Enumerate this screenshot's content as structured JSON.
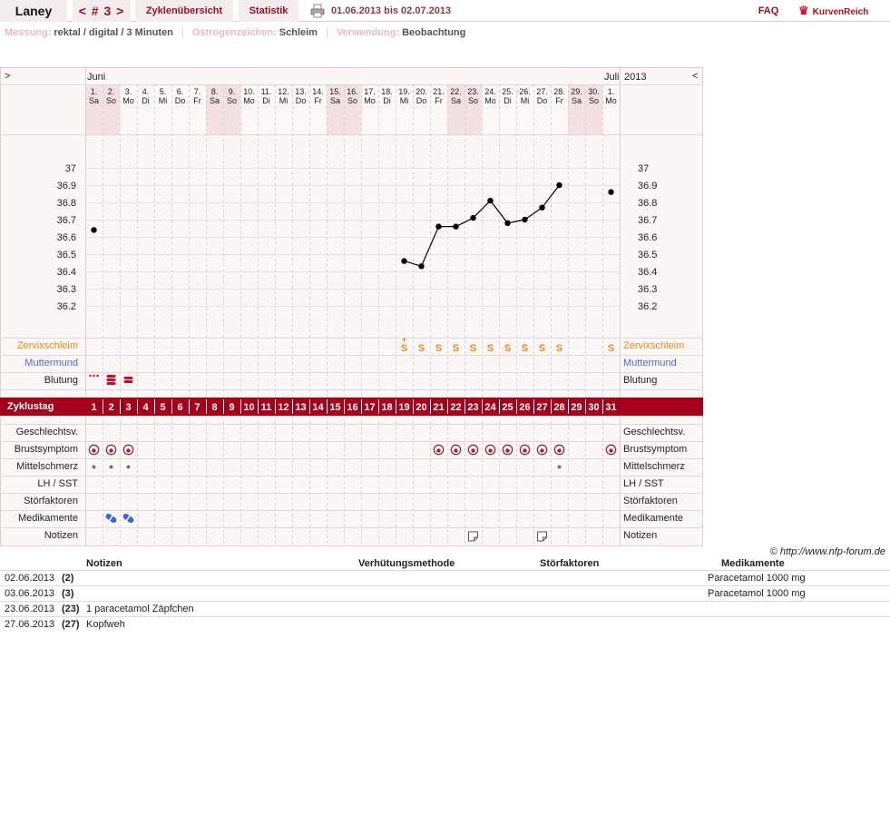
{
  "header": {
    "username": "Laney",
    "cycle_nav": "< # 3 >",
    "tab_overview": "Zyklenübersicht",
    "tab_stats": "Statistik",
    "date_range": "01.06.2013 bis 02.07.2013",
    "faq": "FAQ",
    "brand": "KurvenReich",
    "printer_icon": "printer-icon"
  },
  "info": {
    "measure_label": "Messung:",
    "measure_value": "rektal / digital / 3 Minuten",
    "oestrogen_label": "Östrogenzeichen:",
    "oestrogen_value": "Schleim",
    "usage_label": "Verwendung:",
    "usage_value": "Beobachtung"
  },
  "chart_data": {
    "type": "line",
    "nav_prev": ">",
    "nav_next": "<",
    "month_start": "Juni",
    "month_end": "Juli",
    "year": "2013",
    "days": [
      {
        "d": "1.",
        "w": "Sa",
        "we": true
      },
      {
        "d": "2.",
        "w": "So",
        "we": true
      },
      {
        "d": "3.",
        "w": "Mo",
        "we": false
      },
      {
        "d": "4.",
        "w": "Di",
        "we": false
      },
      {
        "d": "5.",
        "w": "Mi",
        "we": false
      },
      {
        "d": "6.",
        "w": "Do",
        "we": false
      },
      {
        "d": "7.",
        "w": "Fr",
        "we": false
      },
      {
        "d": "8.",
        "w": "Sa",
        "we": true
      },
      {
        "d": "9.",
        "w": "So",
        "we": true
      },
      {
        "d": "10.",
        "w": "Mo",
        "we": false
      },
      {
        "d": "11.",
        "w": "Di",
        "we": false
      },
      {
        "d": "12.",
        "w": "Mi",
        "we": false
      },
      {
        "d": "13.",
        "w": "Do",
        "we": false
      },
      {
        "d": "14.",
        "w": "Fr",
        "we": false
      },
      {
        "d": "15.",
        "w": "Sa",
        "we": true
      },
      {
        "d": "16.",
        "w": "So",
        "we": true
      },
      {
        "d": "17.",
        "w": "Mo",
        "we": false
      },
      {
        "d": "18.",
        "w": "Di",
        "we": false
      },
      {
        "d": "19.",
        "w": "Mi",
        "we": false
      },
      {
        "d": "20.",
        "w": "Do",
        "we": false
      },
      {
        "d": "21.",
        "w": "Fr",
        "we": false
      },
      {
        "d": "22.",
        "w": "Sa",
        "we": true
      },
      {
        "d": "23.",
        "w": "So",
        "we": true
      },
      {
        "d": "24.",
        "w": "Mo",
        "we": false
      },
      {
        "d": "25.",
        "w": "Di",
        "we": false
      },
      {
        "d": "26.",
        "w": "Mi",
        "we": false
      },
      {
        "d": "27.",
        "w": "Do",
        "we": false
      },
      {
        "d": "28.",
        "w": "Fr",
        "we": false
      },
      {
        "d": "29.",
        "w": "Sa",
        "we": true
      },
      {
        "d": "30.",
        "w": "So",
        "we": true
      },
      {
        "d": "1.",
        "w": "Mo",
        "we": false
      }
    ],
    "y_ticks": [
      "37",
      "36.9",
      "36.8",
      "36.7",
      "36.6",
      "36.5",
      "36.4",
      "36.3",
      "36.2"
    ],
    "ylim": [
      36.1,
      37.05
    ],
    "temperatures": [
      36.64,
      null,
      null,
      null,
      null,
      null,
      null,
      null,
      null,
      null,
      null,
      null,
      null,
      null,
      null,
      null,
      null,
      null,
      36.46,
      36.43,
      36.66,
      36.66,
      36.71,
      36.81,
      36.68,
      36.7,
      36.77,
      36.9,
      null,
      null,
      36.86
    ],
    "row_labels": {
      "cervix": "Zervixschleim",
      "os": "Muttermund",
      "bleeding": "Blutung",
      "cycle_day": "Zyklustag",
      "intercourse": "Geschlechtsv.",
      "breast": "Brustsymptom",
      "midpain": "Mittelschmerz",
      "lh": "LH / SST",
      "disturb": "Störfaktoren",
      "meds": "Medikamente",
      "notes": "Notizen"
    },
    "cervix_marks": [
      "",
      "",
      "",
      "",
      "",
      "",
      "",
      "",
      "",
      "",
      "",
      "",
      "",
      "",
      "",
      "",
      "",
      "",
      "S+",
      "S",
      "S",
      "S",
      "S",
      "S",
      "S",
      "S",
      "S",
      "S",
      "",
      "",
      "S"
    ],
    "bleeding_level": [
      1,
      3,
      2,
      0,
      0,
      0,
      0,
      0,
      0,
      0,
      0,
      0,
      0,
      0,
      0,
      0,
      0,
      0,
      0,
      0,
      0,
      0,
      0,
      0,
      0,
      0,
      0,
      0,
      0,
      0,
      0
    ],
    "breast_days": [
      1,
      2,
      3,
      21,
      22,
      23,
      24,
      25,
      26,
      27,
      28,
      31
    ],
    "midpain_days": [
      1,
      2,
      3,
      28
    ],
    "meds_days": [
      2,
      3
    ],
    "notes_days": [
      23,
      27
    ],
    "colors": {
      "cycle_bar": "#a4001c",
      "weekend": "#f4e0e3",
      "weekday": "#fbf5f5",
      "cervix": "#e8891a",
      "os": "#4a6acd",
      "bleeding": "#e2001a",
      "breast": "#8d2d3c",
      "meds": "#3b64d4"
    }
  },
  "copyright": "© http://www.nfp-forum.de",
  "notes_table": {
    "headers": {
      "notes": "Notizen",
      "contraception": "Verhütungsmethode",
      "disturb": "Störfaktoren",
      "meds": "Medikamente"
    },
    "rows": [
      {
        "date": "02.06.2013",
        "day": "(2)",
        "note": "",
        "med": "Paracetamol 1000 mg"
      },
      {
        "date": "03.06.2013",
        "day": "(3)",
        "note": "",
        "med": "Paracetamol 1000 mg"
      },
      {
        "date": "23.06.2013",
        "day": "(23)",
        "note": "1 paracetamol Zäpfchen",
        "med": ""
      },
      {
        "date": "27.06.2013",
        "day": "(27)",
        "note": "Kopfweh",
        "med": ""
      }
    ]
  }
}
